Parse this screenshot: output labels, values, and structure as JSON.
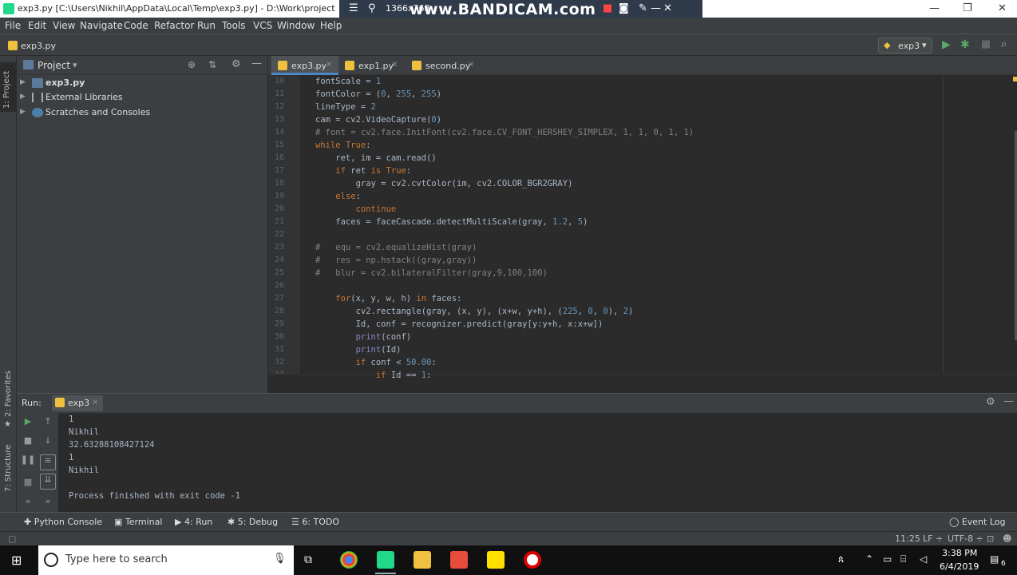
{
  "window": {
    "title": "exp3.py [C:\\Users\\Nikhil\\AppData\\Local\\Temp\\exp3.py] - D:\\Work\\project\\Doo",
    "min": "—",
    "max": "❐",
    "close": "✕"
  },
  "bandicam": {
    "resolution": "1366x768",
    "brand": "www.BANDICAM.com"
  },
  "menu": [
    "File",
    "Edit",
    "View",
    "Navigate",
    "Code",
    "Refactor",
    "Run",
    "Tools",
    "VCS",
    "Window",
    "Help"
  ],
  "nav": {
    "breadcrumb": "exp3.py",
    "run_config": "exp3"
  },
  "side_strip": {
    "project": "1: Project",
    "favorites": "2: Favorites",
    "structure": "7: Structure"
  },
  "project": {
    "header": "Project",
    "items": [
      {
        "label": "exp3.py"
      },
      {
        "label": "External Libraries"
      },
      {
        "label": "Scratches and Consoles"
      }
    ]
  },
  "tabs": [
    {
      "label": "exp3.py",
      "active": true
    },
    {
      "label": "exp1.py",
      "active": false
    },
    {
      "label": "second.py",
      "active": false
    }
  ],
  "code": {
    "lines": [
      {
        "n": "10",
        "text": "fontScale = 1"
      },
      {
        "n": "11",
        "text": "fontColor = (0, 255, 255)"
      },
      {
        "n": "12",
        "text": "lineType = 2"
      },
      {
        "n": "13",
        "text": "cam = cv2.VideoCapture(0)"
      },
      {
        "n": "14",
        "text": "# font = cv2.face.InitFont(cv2.face.CV_FONT_HERSHEY_SIMPLEX, 1, 1, 0, 1, 1)"
      },
      {
        "n": "15",
        "text": "while True:"
      },
      {
        "n": "16",
        "text": "    ret, im = cam.read()"
      },
      {
        "n": "17",
        "text": "    if ret is True:"
      },
      {
        "n": "18",
        "text": "        gray = cv2.cvtColor(im, cv2.COLOR_BGR2GRAY)"
      },
      {
        "n": "19",
        "text": "    else:"
      },
      {
        "n": "20",
        "text": "        continue"
      },
      {
        "n": "21",
        "text": "    faces = faceCascade.detectMultiScale(gray, 1.2, 5)"
      },
      {
        "n": "22",
        "text": ""
      },
      {
        "n": "23",
        "text": "#   equ = cv2.equalizeHist(gray)"
      },
      {
        "n": "24",
        "text": "#   res = np.hstack((gray,gray))"
      },
      {
        "n": "25",
        "text": "#   blur = cv2.bilateralFilter(gray,9,100,100)"
      },
      {
        "n": "26",
        "text": ""
      },
      {
        "n": "27",
        "text": "    for(x, y, w, h) in faces:"
      },
      {
        "n": "28",
        "text": "        cv2.rectangle(gray, (x, y), (x+w, y+h), (225, 0, 0), 2)"
      },
      {
        "n": "29",
        "text": "        Id, conf = recognizer.predict(gray[y:y+h, x:x+w])"
      },
      {
        "n": "30",
        "text": "        print(conf)"
      },
      {
        "n": "31",
        "text": "        print(Id)"
      },
      {
        "n": "32",
        "text": "        if conf < 50.00:"
      },
      {
        "n": "33",
        "text": "            if Id == 1:"
      }
    ]
  },
  "run": {
    "label": "Run:",
    "tab": "exp3",
    "output": [
      "1",
      "Nikhil",
      "32.63288108427124",
      "1",
      "Nikhil",
      "",
      "Process finished with exit code -1"
    ]
  },
  "bottom_tabs": [
    "Python Console",
    "Terminal",
    "4: Run",
    "5: Debug",
    "6: TODO"
  ],
  "event_log": "Event Log",
  "status": {
    "pos": "11:25",
    "lf": "LF ÷",
    "enc": "UTF-8 ÷"
  },
  "taskbar": {
    "search": "Type here to search",
    "time": "3:38 PM",
    "date": "6/4/2019",
    "notif": "6"
  },
  "colors": {
    "ide_bg": "#2b2b2b",
    "panel": "#3c3f41",
    "keyword": "#cc7832",
    "number": "#6897bb",
    "comment": "#808080",
    "active_tab": "#4a88c7"
  }
}
